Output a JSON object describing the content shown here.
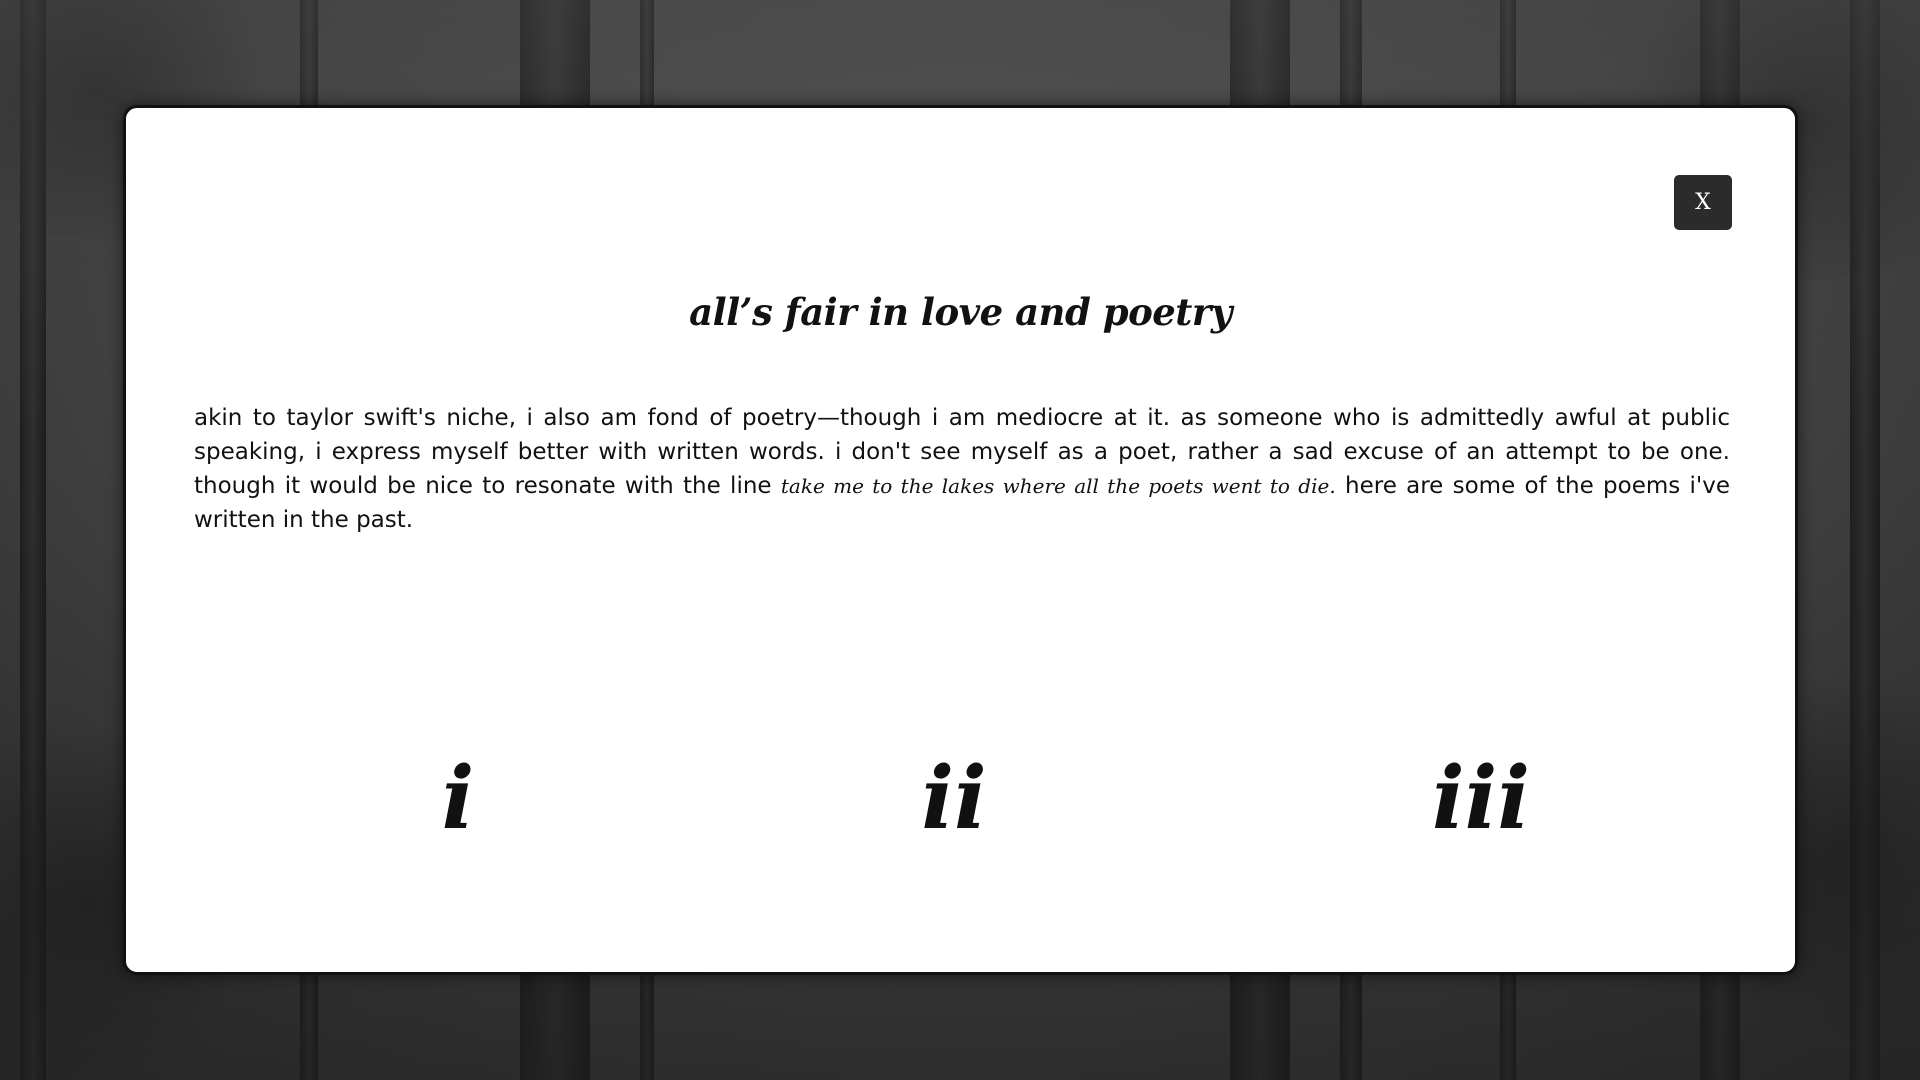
{
  "modal": {
    "close_label": "X",
    "title": "all’s fair in love and poetry",
    "intro_before": "akin to taylor swift's niche, i also am fond of poetry—though i am mediocre at it. as someone who is admittedly awful at public speaking, i express myself better with written words. i don't see myself as a poet, rather a sad excuse of an attempt to be one. though it would be nice to resonate with the line ",
    "intro_quote": "take me to the lakes where all the poets went to die.",
    "intro_after": " here are some of the poems i've written in the past."
  },
  "poems": [
    {
      "label": "i"
    },
    {
      "label": "ii"
    },
    {
      "label": "iii"
    }
  ]
}
